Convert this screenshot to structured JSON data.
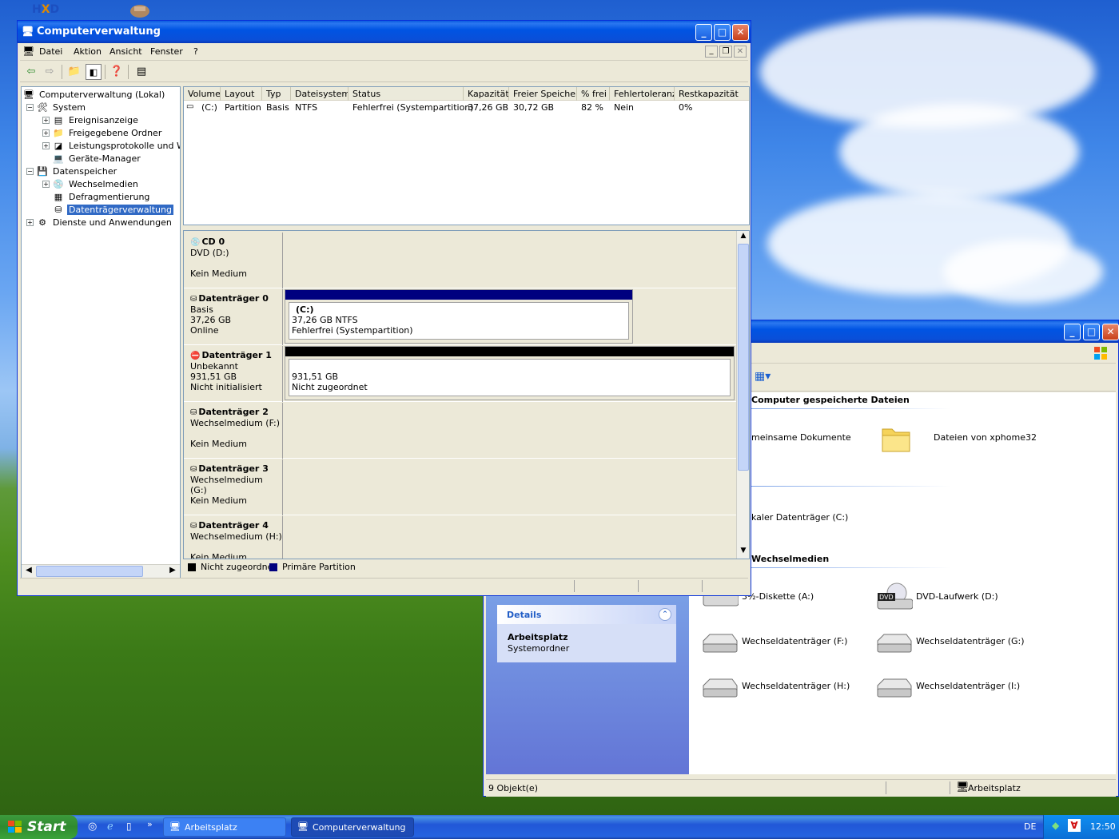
{
  "desktop": {
    "icons": [
      "hxd-icon",
      "network-icon"
    ]
  },
  "compmgmt": {
    "title": "Computerverwaltung",
    "menu": [
      "Datei",
      "Aktion",
      "Ansicht",
      "Fenster",
      "?"
    ],
    "tree": [
      {
        "label": "Computerverwaltung (Lokal)",
        "level": 0,
        "expander": "",
        "icon": "computer-mgmt-icon"
      },
      {
        "label": "System",
        "level": 1,
        "expander": "−",
        "icon": "tools-icon"
      },
      {
        "label": "Ereignisanzeige",
        "level": 2,
        "expander": "+",
        "icon": "event-viewer-icon"
      },
      {
        "label": "Freigegebene Ordner",
        "level": 2,
        "expander": "+",
        "icon": "shared-folder-icon"
      },
      {
        "label": "Leistungsprotokolle und Warn",
        "level": 2,
        "expander": "+",
        "icon": "performance-icon"
      },
      {
        "label": "Geräte-Manager",
        "level": 2,
        "expander": "",
        "icon": "device-manager-icon"
      },
      {
        "label": "Datenspeicher",
        "level": 1,
        "expander": "−",
        "icon": "storage-icon"
      },
      {
        "label": "Wechselmedien",
        "level": 2,
        "expander": "+",
        "icon": "removable-media-icon"
      },
      {
        "label": "Defragmentierung",
        "level": 2,
        "expander": "",
        "icon": "defrag-icon"
      },
      {
        "label": "Datenträgerverwaltung",
        "level": 2,
        "expander": "",
        "icon": "disk-mgmt-icon",
        "selected": true
      },
      {
        "label": "Dienste und Anwendungen",
        "level": 1,
        "expander": "+",
        "icon": "services-icon"
      }
    ],
    "columns": [
      "Volume",
      "Layout",
      "Typ",
      "Dateisystem",
      "Status",
      "Kapazität",
      "Freier Speicher",
      "% frei",
      "Fehlertoleranz",
      "Restkapazität"
    ],
    "volume_rows": [
      [
        "(C:)",
        "Partition",
        "Basis",
        "NTFS",
        "Fehlerfrei (Systempartition)",
        "37,26 GB",
        "30,72 GB",
        "82 %",
        "Nein",
        "0%"
      ]
    ],
    "disks": [
      {
        "name": "CD 0",
        "line2": "DVD (D:)",
        "line3": "",
        "line4": "Kein Medium",
        "icon": "cd-drive-icon"
      },
      {
        "name": "Datenträger 0",
        "line2": "Basis",
        "line3": "37,26 GB",
        "line4": "Online",
        "icon": "disk-icon",
        "partition": {
          "label": "(C:)",
          "size": "37,26 GB NTFS",
          "status": "Fehlerfrei (Systempartition)",
          "color": "#00007f"
        }
      },
      {
        "name": "Datenträger 1",
        "line2": "Unbekannt",
        "line3": "931,51 GB",
        "line4": "Nicht initialisiert",
        "icon": "disk-uninitialized-icon",
        "partition": {
          "label": "",
          "size": "931,51 GB",
          "status": "Nicht zugeordnet",
          "color": "#000000"
        }
      },
      {
        "name": "Datenträger 2",
        "line2": "Wechselmedium (F:)",
        "line3": "",
        "line4": "Kein Medium",
        "icon": "removable-disk-icon"
      },
      {
        "name": "Datenträger 3",
        "line2": "Wechselmedium (G:)",
        "line3": "",
        "line4": "Kein Medium",
        "icon": "removable-disk-icon"
      },
      {
        "name": "Datenträger 4",
        "line2": "Wechselmedium (H:)",
        "line3": "",
        "line4": "Kein Medium",
        "icon": "removable-disk-icon"
      }
    ],
    "legend": [
      {
        "label": "Nicht zugeordnet",
        "color": "#000000"
      },
      {
        "label": "Primäre Partition",
        "color": "#00007f"
      }
    ]
  },
  "explorer": {
    "section_files": "Computer gespeicherte Dateien",
    "section_removable": "Wechselmedien",
    "items_files": [
      "meinsame Dokumente",
      "Dateien von xphome32"
    ],
    "item_local": "kaler Datenträger (C:)",
    "items_removable": [
      "3½-Diskette (A:)",
      "DVD-Laufwerk (D:)",
      "Wechseldatenträger (F:)",
      "Wechseldatenträger (G:)",
      "Wechseldatenträger (H:)",
      "Wechseldatenträger (I:)"
    ],
    "details": {
      "title": "Details",
      "name": "Arbeitsplatz",
      "type": "Systemordner"
    },
    "status_count": "9 Objekt(e)",
    "status_location": "Arbeitsplatz"
  },
  "taskbar": {
    "start": "Start",
    "tasks": [
      "Arbeitsplatz",
      "Computerverwaltung"
    ],
    "language": "DE",
    "clock": "12:50"
  }
}
